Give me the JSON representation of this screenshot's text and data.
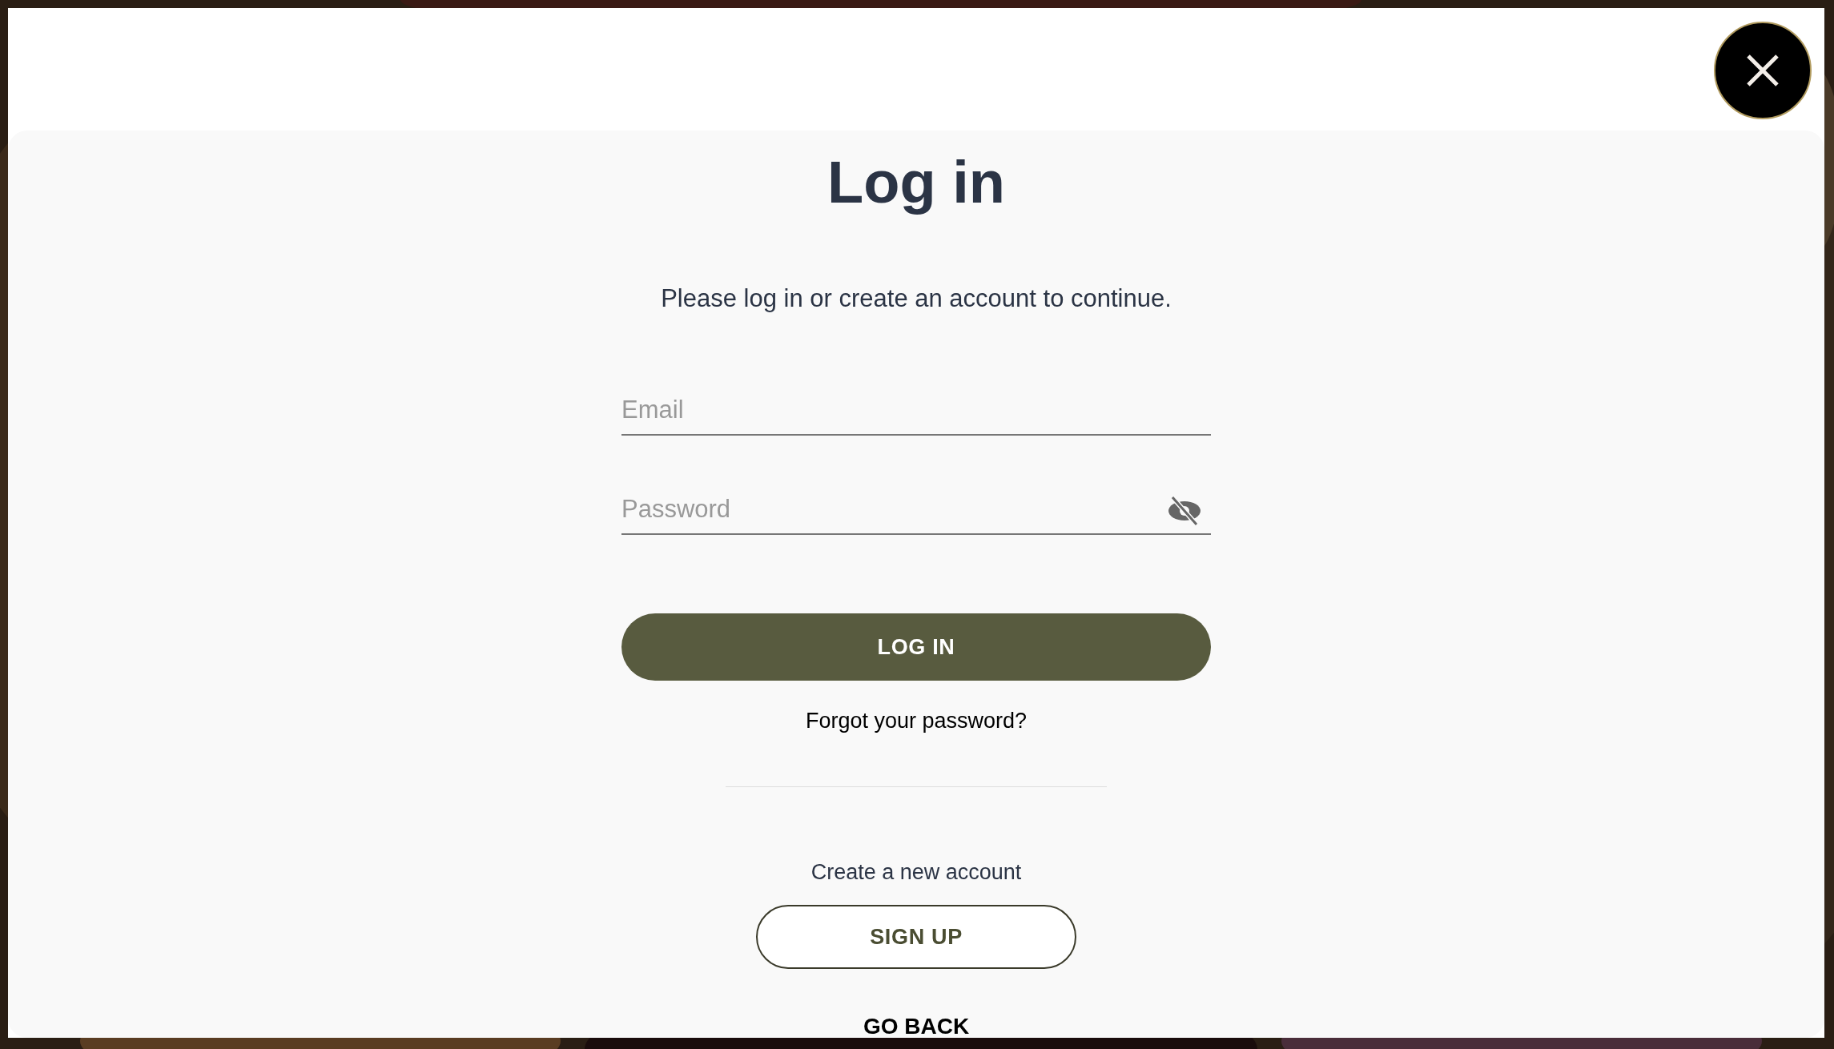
{
  "dialog": {
    "title": "Log in",
    "subtitle": "Please log in or create an account to continue.",
    "fields": [
      {
        "kind": "text",
        "placeholder": "Email"
      },
      {
        "kind": "password",
        "placeholder": "Password"
      }
    ],
    "login_button": "LOG IN",
    "forgot_link": "Forgot your password?",
    "create_label": "Create a new account",
    "signup_button": "SIGN UP",
    "back_link": "GO BACK"
  }
}
